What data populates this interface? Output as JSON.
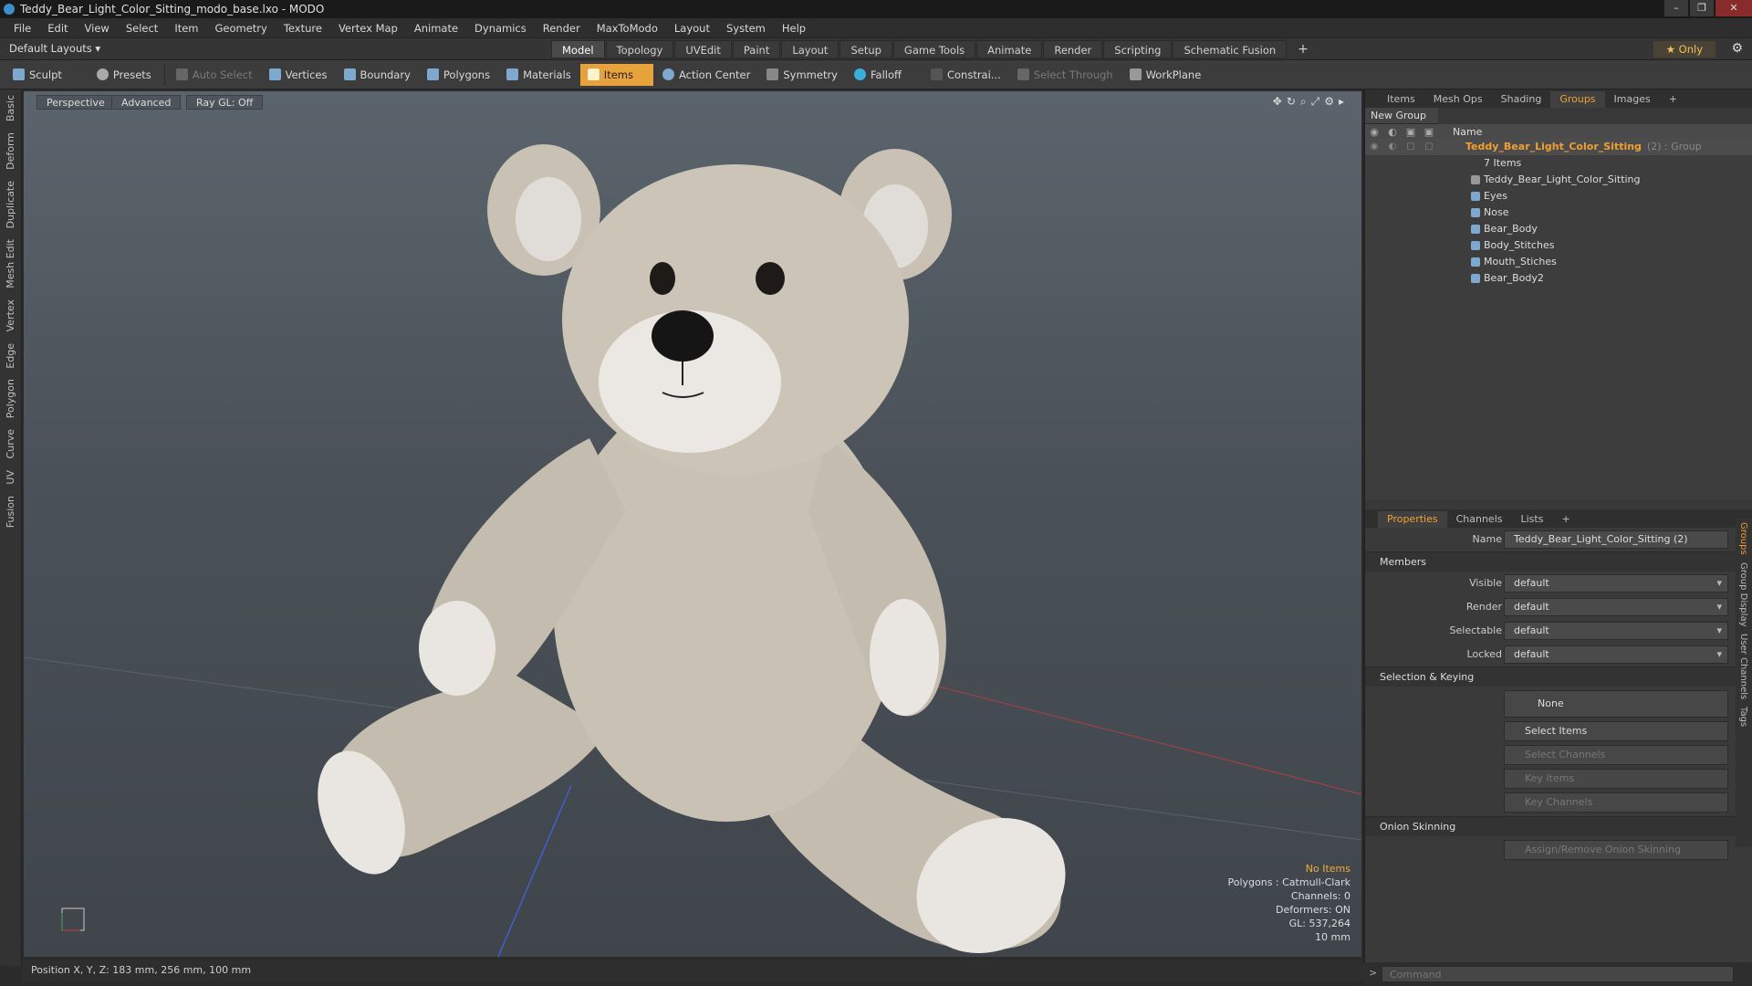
{
  "window": {
    "title": "Teddy_Bear_Light_Color_Sitting_modo_base.lxo - MODO"
  },
  "menu": [
    "File",
    "Edit",
    "View",
    "Select",
    "Item",
    "Geometry",
    "Texture",
    "Vertex Map",
    "Animate",
    "Dynamics",
    "Render",
    "MaxToModo",
    "Layout",
    "System",
    "Help"
  ],
  "layout": {
    "default_layouts": "Default Layouts ▾",
    "tabs": [
      "Model",
      "Topology",
      "UVEdit",
      "Paint",
      "Layout",
      "Setup",
      "Game Tools",
      "Animate",
      "Render",
      "Scripting",
      "Schematic Fusion"
    ],
    "active_tab": "Model",
    "only_label": "★  Only"
  },
  "toolbar": {
    "sculpt": "Sculpt",
    "presets": "Presets",
    "auto_select": "Auto Select",
    "vertices": "Vertices",
    "boundary": "Boundary",
    "polygons": "Polygons",
    "materials": "Materials",
    "items": "Items",
    "action_center": "Action Center",
    "symmetry": "Symmetry",
    "falloff": "Falloff",
    "constraints": "Constrai...",
    "select_through": "Select Through",
    "workplane": "WorkPlane"
  },
  "left_tabs": [
    "Basic",
    "Deform",
    "Duplicate",
    "Mesh Edit",
    "Vertex",
    "Edge",
    "Polygon",
    "Curve",
    "UV",
    "Fusion"
  ],
  "viewport": {
    "perspective": "Perspective",
    "advanced": "Advanced",
    "raygl": "Ray GL: Off",
    "info": {
      "no_items": "No Items",
      "polygons": "Polygons : Catmull-Clark",
      "channels": "Channels: 0",
      "deformers": "Deformers: ON",
      "gl": "GL: 537,264",
      "scale": "10 mm"
    }
  },
  "status": {
    "position": "Position X, Y, Z:   183 mm, 256 mm, 100 mm"
  },
  "panel": {
    "tabs": [
      "Items",
      "Mesh Ops",
      "Shading",
      "Groups",
      "Images"
    ],
    "active_tab": "Groups",
    "new_group": "New Group",
    "name_col": "Name",
    "group_name": "Teddy_Bear_Light_Color_Sitting",
    "group_tag": "(2) : Group",
    "item_count": "7 Items",
    "children": [
      "Teddy_Bear_Light_Color_Sitting",
      "Eyes",
      "Nose",
      "Bear_Body",
      "Body_Stitches",
      "Mouth_Stiches",
      "Bear_Body2"
    ]
  },
  "properties": {
    "tabs": [
      "Properties",
      "Channels",
      "Lists"
    ],
    "active_tab": "Properties",
    "name_label": "Name",
    "name_value": "Teddy_Bear_Light_Color_Sitting (2)",
    "members": "Members",
    "visible_label": "Visible",
    "render_label": "Render",
    "selectable_label": "Selectable",
    "locked_label": "Locked",
    "default_value": "default",
    "selection_keying": "Selection & Keying",
    "none": "None",
    "select_items": "Select Items",
    "select_channels": "Select Channels",
    "key_items": "Key Items",
    "key_channels": "Key Channels",
    "onion": "Onion Skinning",
    "onion_btn": "Assign/Remove Onion Skinning",
    "side_tabs": [
      "Groups",
      "Group Display",
      "User Channels",
      "Tags"
    ]
  },
  "command": {
    "placeholder": "Command"
  },
  "colors": {
    "accent": "#e8a23a",
    "bear": "#c9c1b4",
    "paw": "#e9e6e1"
  }
}
